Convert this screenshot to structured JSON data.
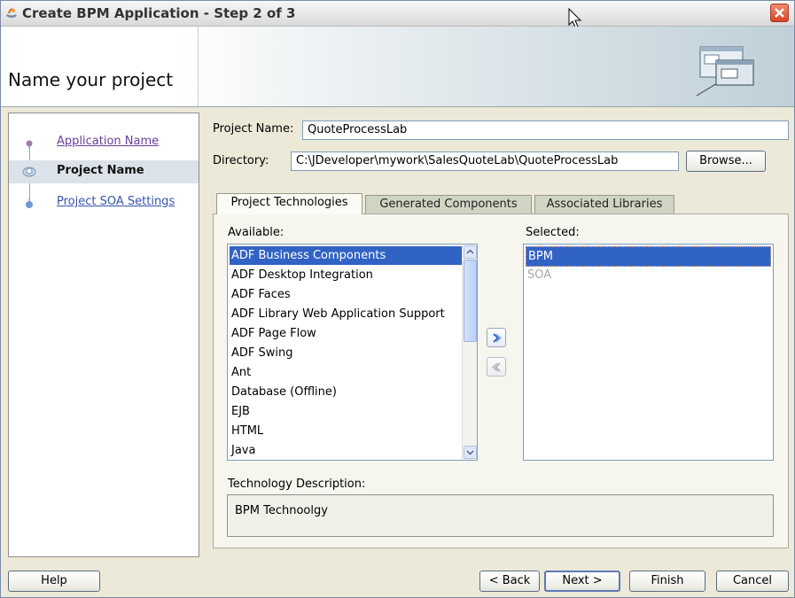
{
  "window": {
    "title": "Create BPM Application - Step 2 of 3"
  },
  "header": {
    "title": "Name your project"
  },
  "nav": {
    "items": [
      {
        "label": "Application Name",
        "state": "visited"
      },
      {
        "label": "Project Name",
        "state": "active"
      },
      {
        "label": "Project SOA Settings",
        "state": "link"
      }
    ]
  },
  "form": {
    "project_name_label": "Project Name:",
    "project_name_value": "QuoteProcessLab",
    "directory_label": "Directory:",
    "directory_value": "C:\\JDeveloper\\mywork\\SalesQuoteLab\\QuoteProcessLab",
    "browse_label": "Browse..."
  },
  "tabs": [
    {
      "label": "Project Technologies",
      "active": true
    },
    {
      "label": "Generated Components",
      "active": false
    },
    {
      "label": "Associated Libraries",
      "active": false
    }
  ],
  "available": {
    "label": "Available:",
    "items": [
      "ADF Business Components",
      "ADF Desktop Integration",
      "ADF Faces",
      "ADF Library Web Application Support",
      "ADF Page Flow",
      "ADF Swing",
      "Ant",
      "Database (Offline)",
      "EJB",
      "HTML",
      "Java"
    ],
    "selected_index": 0
  },
  "selected": {
    "label": "Selected:",
    "items": [
      "BPM",
      "SOA"
    ],
    "selected_index": 0
  },
  "description": {
    "label": "Technology Description:",
    "text": "BPM Technoolgy"
  },
  "footer": {
    "help_label": "Help",
    "back_label": "< Back",
    "next_label": "Next >",
    "finish_label": "Finish",
    "cancel_label": "Cancel"
  },
  "colors": {
    "selection": "#3163c5",
    "link": "#3355aa",
    "visited_link": "#6a3d9a",
    "close_button": "#d8442a"
  }
}
